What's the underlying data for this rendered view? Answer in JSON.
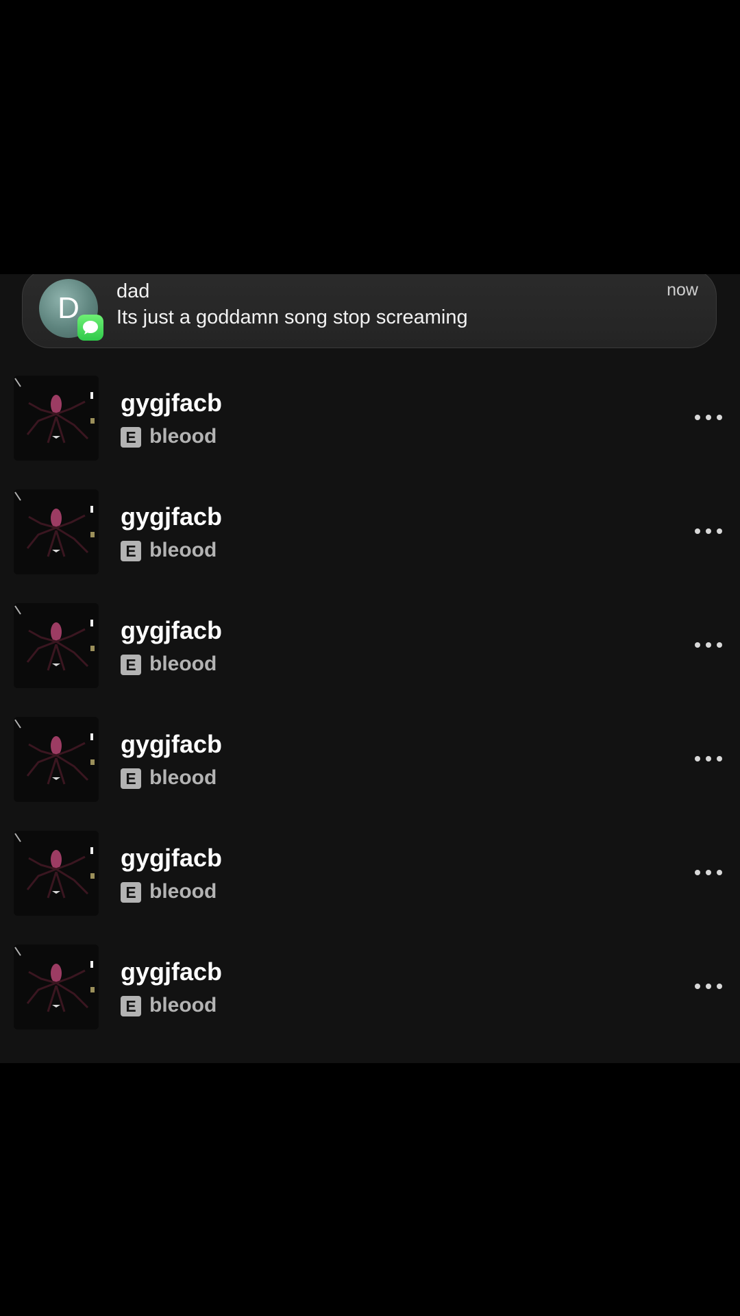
{
  "notification": {
    "avatar_letter": "D",
    "app_icon": "messages-icon",
    "sender": "dad",
    "message": "Its just a goddamn song stop screaming",
    "time": "now"
  },
  "tracks": [
    {
      "title": "gygjfacb",
      "explicit": "E",
      "artist": "bleood",
      "more_icon": "more-horizontal-icon"
    },
    {
      "title": "gygjfacb",
      "explicit": "E",
      "artist": "bleood",
      "more_icon": "more-horizontal-icon"
    },
    {
      "title": "gygjfacb",
      "explicit": "E",
      "artist": "bleood",
      "more_icon": "more-horizontal-icon"
    },
    {
      "title": "gygjfacb",
      "explicit": "E",
      "artist": "bleood",
      "more_icon": "more-horizontal-icon"
    },
    {
      "title": "gygjfacb",
      "explicit": "E",
      "artist": "bleood",
      "more_icon": "more-horizontal-icon"
    },
    {
      "title": "gygjfacb",
      "explicit": "E",
      "artist": "bleood",
      "more_icon": "more-horizontal-icon"
    }
  ],
  "colors": {
    "background": "#121212",
    "letterbox": "#000000",
    "title": "#ffffff",
    "secondary": "#b3b3b3",
    "messages_green": "#34c759",
    "avatar": "#5e847e"
  }
}
